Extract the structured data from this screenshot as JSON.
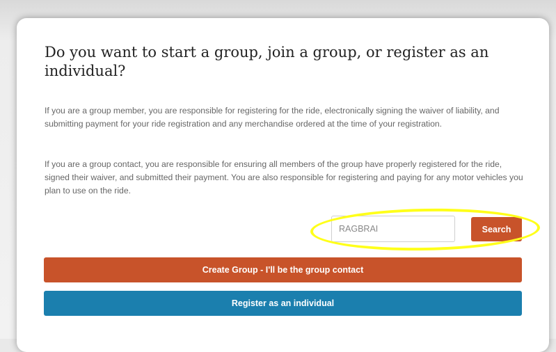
{
  "question": {
    "title": "Do you want to start a group, join a group, or register as an individual?"
  },
  "info": {
    "group_member_text": "If you are a group member, you are responsible for registering for the ride, electronically signing the waiver of liability, and submitting payment for your ride registration and any merchandise ordered at the time of your registration.",
    "group_contact_text": "If you are a group contact, you are responsible for ensuring all members of the group have properly registered for the ride, signed their waiver, and submitted their payment. You are also responsible for registering and paying for any motor vehicles you plan to use on the ride."
  },
  "search": {
    "value": "RAGBRAI",
    "button_label": "Search"
  },
  "actions": {
    "create_group_label": "Create Group - I'll be the group contact",
    "register_individual_label": "Register as an individual"
  },
  "colors": {
    "primary_orange": "#c8532a",
    "primary_blue": "#1b7fae",
    "highlight_yellow": "#ffff1a"
  }
}
